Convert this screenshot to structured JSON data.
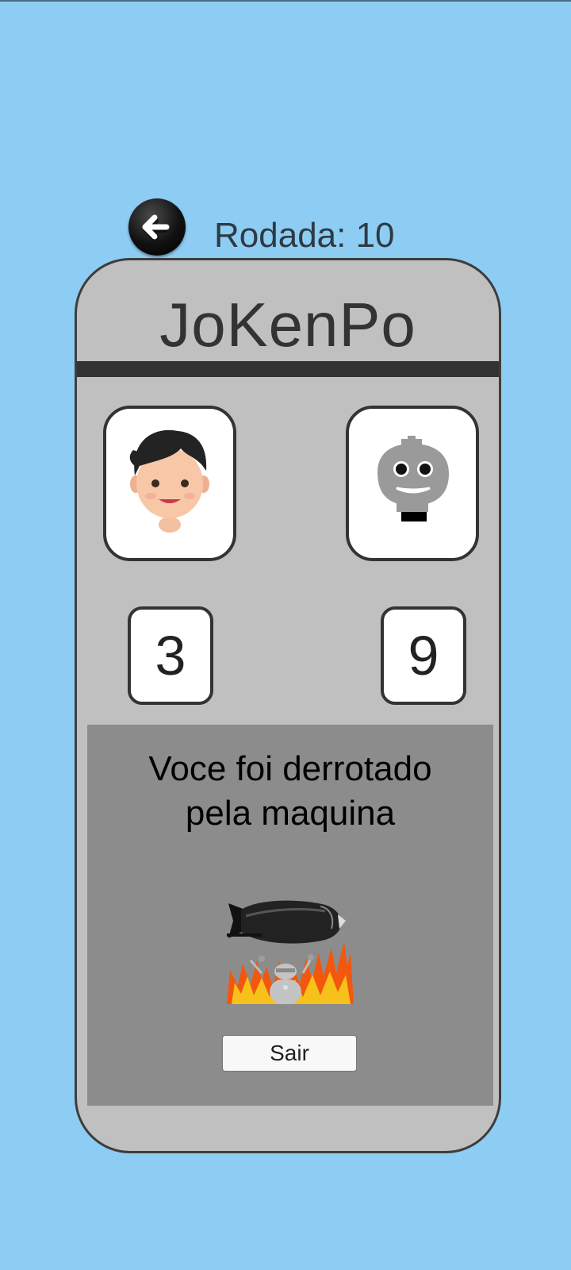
{
  "header": {
    "round_label": "Rodada: 10",
    "back_icon": "arrow-left-icon"
  },
  "game": {
    "title": "JoKenPo",
    "player": {
      "avatar": "person-face-icon",
      "score": "3"
    },
    "cpu": {
      "avatar": "robot-head-icon",
      "score": "9"
    }
  },
  "result": {
    "message": "Voce foi derrotado pela maquina",
    "image": "bomb-robot-fire-image",
    "exit_label": "Sair"
  },
  "colors": {
    "background": "#8ecdf3",
    "device": "#c0c0c0",
    "result_panel": "#8c8c8c",
    "border": "#333333"
  }
}
